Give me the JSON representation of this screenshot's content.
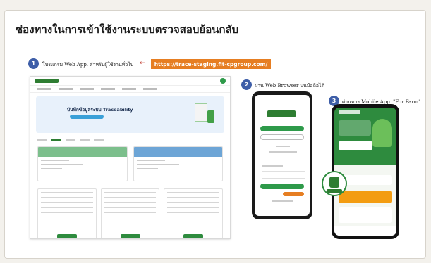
{
  "title": "ช่องทางในการเข้าใช้งานระบบตรวจสอบย้อนกลับ",
  "steps": [
    {
      "num": "1",
      "text": "โปรแกรม Web App. สำหรับผู้ใช้งานทั่วไป"
    },
    {
      "num": "2",
      "text": "ผ่าน Web Browser บนมือถือได้"
    },
    {
      "num": "3",
      "text": "ผ่านทาง Mobile App. \"For Farm\""
    }
  ],
  "url": "https://trace-staging.fit-cpgroup.com/",
  "web_mockup": {
    "banner_title": "บันทึกข้อมูลระบบ Traceability"
  },
  "colors": {
    "step_badge": "#3e5ea8",
    "url_highlight": "#e67e22",
    "brand_green": "#2e7d32"
  }
}
